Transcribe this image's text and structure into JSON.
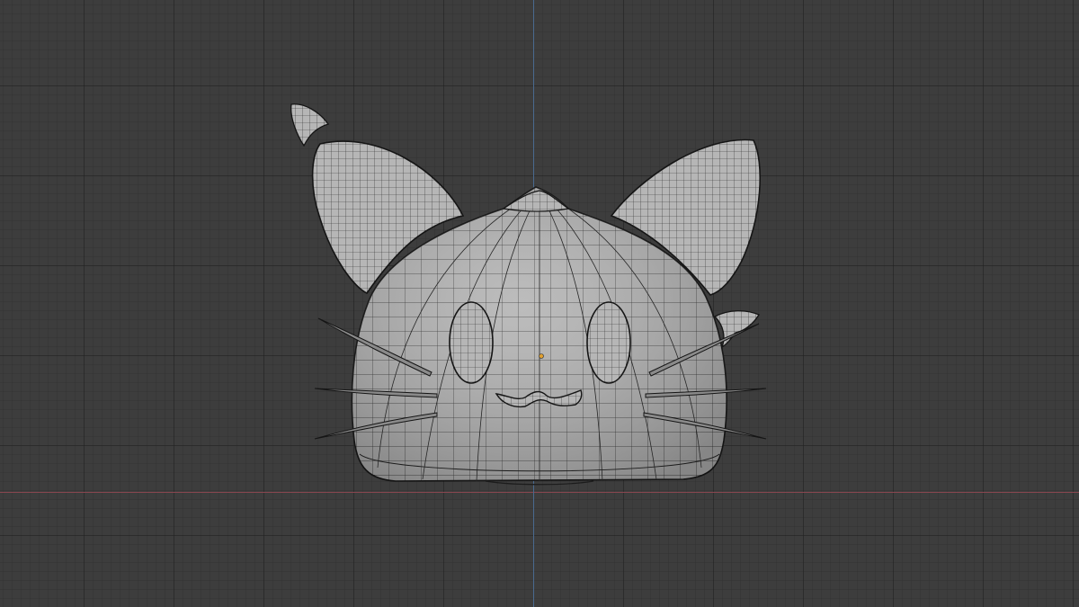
{
  "viewport": {
    "mode": "wireframe-solid",
    "background_color": "#3d3d3d",
    "x_axis_color": "#8a4650",
    "z_axis_color": "#4a6a8f",
    "mesh_fill_color": "#b3b3b3",
    "mesh_edge_color": "#1a1a1a",
    "origin_color": "#e0a030"
  },
  "model": {
    "parts": [
      "body",
      "tip",
      "left-ear",
      "right-ear",
      "left-ear-tip",
      "right-ear-tip",
      "left-eye",
      "right-eye",
      "mouth",
      "whiskers"
    ]
  }
}
